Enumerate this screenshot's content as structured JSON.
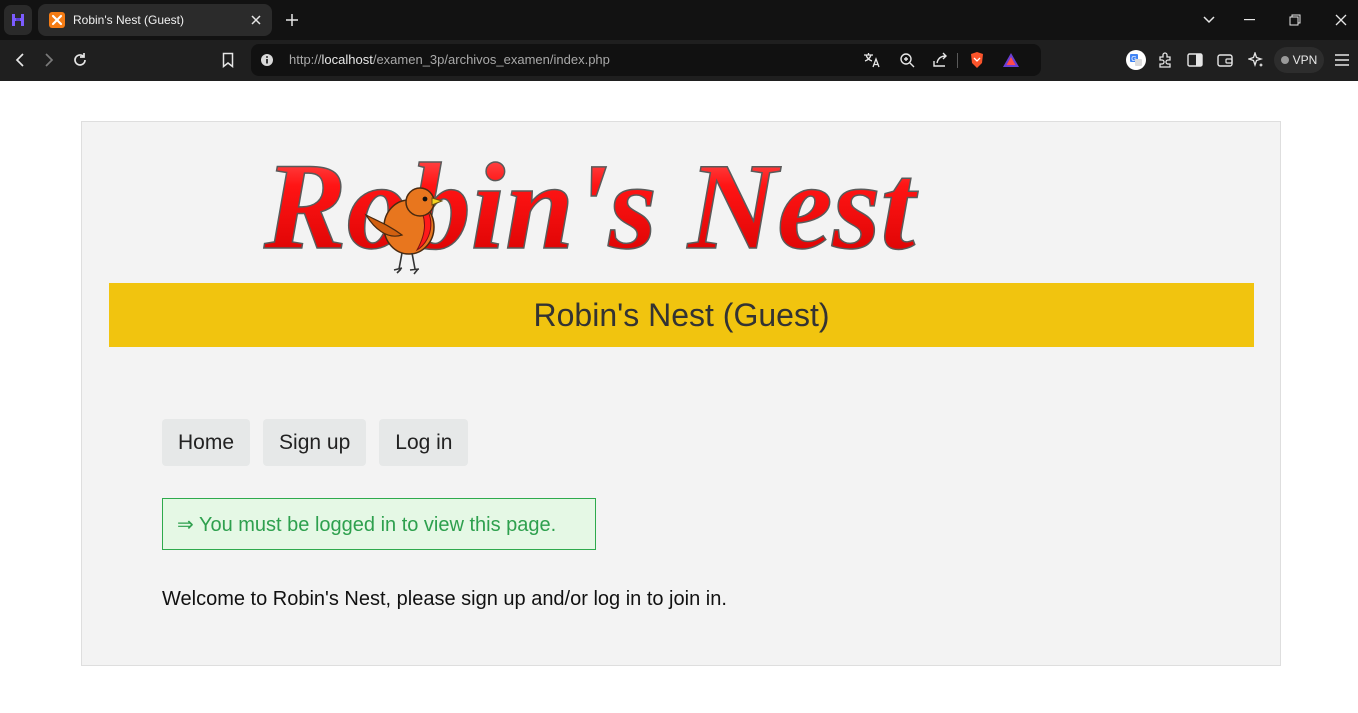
{
  "browser": {
    "tab_title": "Robin's Nest (Guest)",
    "url_prefix": "http://",
    "url_host": "localhost",
    "url_path": "/examen_3p/archivos_examen/index.php",
    "vpn_label": "VPN"
  },
  "page": {
    "logo_text": "Robin's Nest",
    "banner_title": "Robin's Nest (Guest)",
    "nav": [
      {
        "label": "Home"
      },
      {
        "label": "Sign up"
      },
      {
        "label": "Log in"
      }
    ],
    "notice": "⇒ You must be logged in to view this page.",
    "welcome": "Welcome to Robin's Nest, please sign up and/or log in to join in."
  },
  "colors": {
    "banner": "#f1c40f",
    "logo_red": "#ff1010",
    "notice_green": "#2ea04e",
    "notice_bg": "#e5f8e5"
  }
}
